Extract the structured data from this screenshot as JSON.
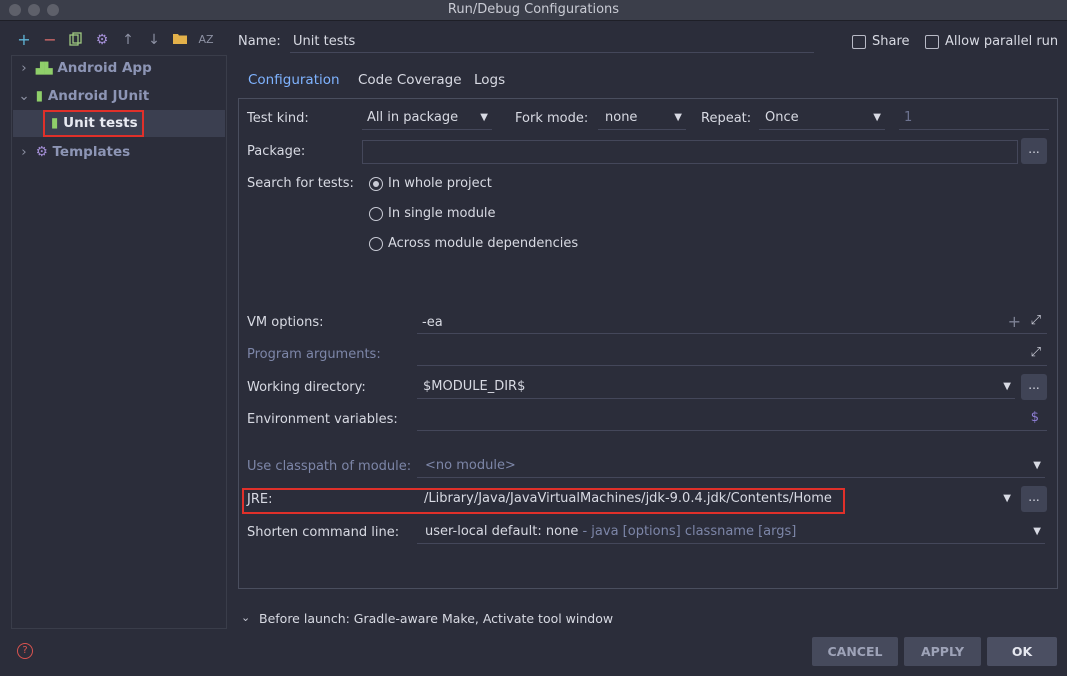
{
  "window": {
    "title": "Run/Debug Configurations"
  },
  "toolbar": {
    "icons": [
      "add-icon",
      "remove-icon",
      "copy-icon",
      "gear-icon",
      "arrow-up-icon",
      "arrow-down-icon",
      "folder-icon",
      "sort-az-icon"
    ]
  },
  "tree": {
    "android_app": "Android App",
    "android_junit": "Android JUnit",
    "unit_tests": "Unit tests",
    "templates": "Templates"
  },
  "header": {
    "name_label": "Name:",
    "name_value": "Unit tests",
    "share_label": "Share",
    "parallel_label": "Allow parallel run"
  },
  "tabs": [
    "Configuration",
    "Code Coverage",
    "Logs"
  ],
  "config": {
    "test_kind_label": "Test kind:",
    "test_kind_value": "All in package",
    "fork_mode_label": "Fork mode:",
    "fork_mode_value": "none",
    "repeat_label": "Repeat:",
    "repeat_value": "Once",
    "repeat_count": "1",
    "package_label": "Package:",
    "package_value": "",
    "search_label": "Search for tests:",
    "search_options": [
      "In whole project",
      "In single module",
      "Across module dependencies"
    ],
    "search_selected": 0,
    "vm_label": "VM options:",
    "vm_value": "-ea",
    "program_args_label": "Program arguments:",
    "working_dir_label": "Working directory:",
    "working_dir_value": "$MODULE_DIR$",
    "env_label": "Environment variables:",
    "classpath_label": "Use classpath of module:",
    "classpath_value": "<no module>",
    "jre_label": "JRE:",
    "jre_value": "/Library/Java/JavaVirtualMachines/jdk-9.0.4.jdk/Contents/Home",
    "shorten_label": "Shorten command line:",
    "shorten_value": "user-local default: none",
    "shorten_hint": "- java [options] classname [args]",
    "dots": "...",
    "dollar": "$"
  },
  "before_launch": "Before launch: Gradle-aware Make, Activate tool window",
  "buttons": {
    "cancel": "CANCEL",
    "apply": "APPLY",
    "ok": "OK",
    "help": "?"
  },
  "colors": {
    "highlight": "#e0302a",
    "accent_tab": "#7fb3ff",
    "android": "#8fcf6a"
  }
}
